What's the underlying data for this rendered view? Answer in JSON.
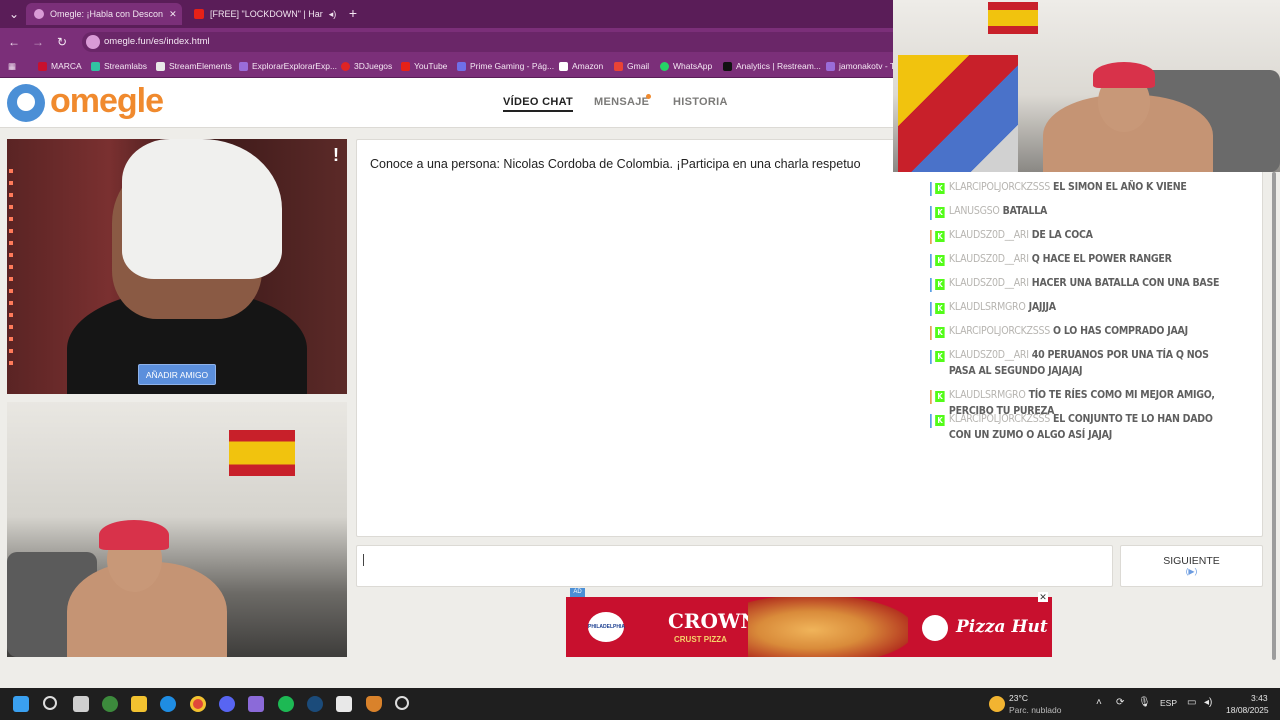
{
  "browser": {
    "tabs": [
      {
        "label": "Omegle: ¡Habla con Descon",
        "active": true
      },
      {
        "label": "[FREE] \"LOCKDOWN\" | Har",
        "active": false
      }
    ],
    "new_tab": "+",
    "url": "omegle.fun/es/index.html",
    "bookmarks": [
      "MARCA",
      "Streamlabs",
      "StreamElements",
      "ExplorarExplorarExp...",
      "3DJuegos",
      "YouTube",
      "Prime Gaming - Pág...",
      "Amazon",
      "Gmail",
      "WhatsApp",
      "Analytics | Restream...",
      "jamonakotv - T"
    ]
  },
  "site": {
    "logo": "omegle",
    "nav": [
      {
        "label": "VÍDEO CHAT",
        "active": true
      },
      {
        "label": "MENSAJE",
        "active": false
      },
      {
        "label": "HISTORIA",
        "active": false
      }
    ]
  },
  "video": {
    "report_glyph": "!",
    "add_friend": "AÑADIR AMIGO"
  },
  "chat": {
    "intro": "Conoce a una persona: Nicolas Cordoba de Colombia. ¡Participa en una charla respetuo",
    "input_value": "",
    "next_label": "SIGUIENTE",
    "next_hint": "(▶)"
  },
  "ad": {
    "tag": "AD",
    "close": "✕",
    "brand_left": "PHILADELPHIA",
    "headline": "CROWN",
    "subline": "CRUST PIZZA",
    "brand_right": "Pizza Hut"
  },
  "stream_chat": [
    {
      "user": "KLARCIPOLJORCKZSSS",
      "text": "EL SIMON EL AÑO K VIENE"
    },
    {
      "user": "LANUSGSO",
      "text": "BATALLA"
    },
    {
      "user": "KLAUDSZ0D__ARI",
      "text": "DE LA COCA"
    },
    {
      "user": "KLAUDSZ0D__ARI",
      "text": "Q HACE EL POWER RANGER"
    },
    {
      "user": "KLAUDSZ0D__ARI",
      "text": "HACER UNA BATALLA CON UNA BASE"
    },
    {
      "user": "KLAUDLSRMGRO",
      "text": "JAJJJA"
    },
    {
      "user": "KLARCIPOLJORCKZSSS",
      "text": "O LO HAS COMPRADO JAAJ"
    },
    {
      "user": "KLAUDSZ0D__ARI",
      "text": "40 PERUANOS POR UNA TÍA Q NOS PASA AL SEGUNDO JAJAJAJ"
    },
    {
      "user": "KLAUDLSRMGRO",
      "text": "TÍO TE RÍES COMO MI MEJOR AMIGO, PERCIBO TU PUREZA"
    },
    {
      "user": "KLARCIPOLJORCKZSSS",
      "text": "EL CONJUNTO TE LO HAN DADO CON UN ZUMO O ALGO ASÍ JAJAJ"
    }
  ],
  "taskbar": {
    "weather_temp": "23°C",
    "weather_desc": "Parc. nublado",
    "lang": "ESP",
    "time": "3:43",
    "date": "18/08/2025"
  }
}
